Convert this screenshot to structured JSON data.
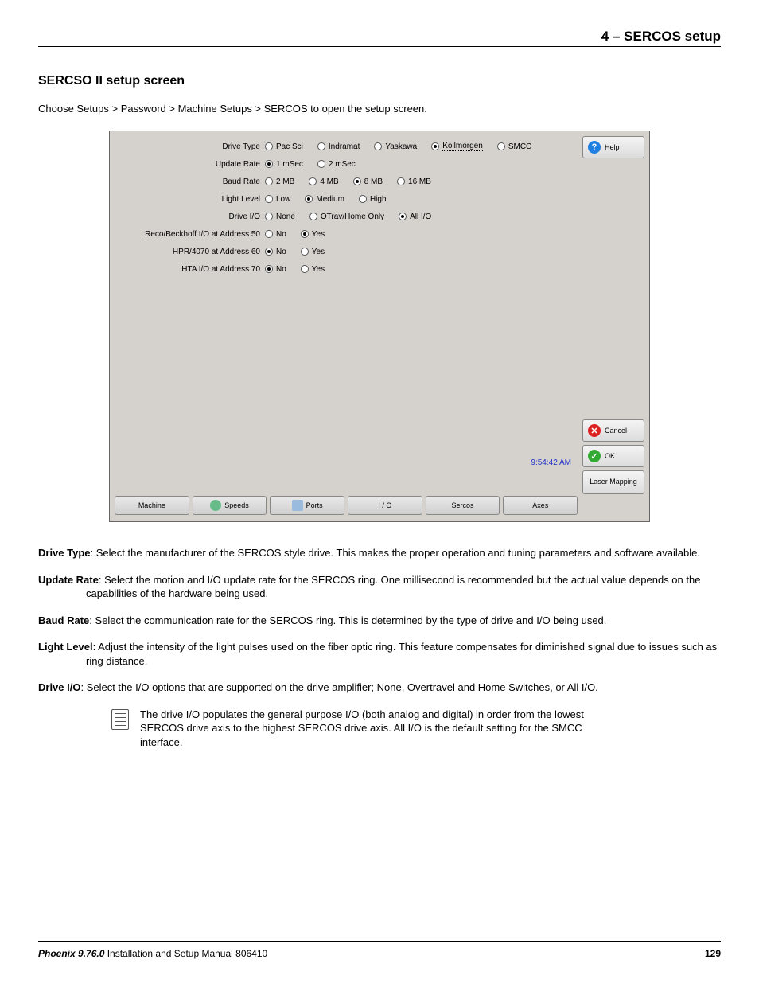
{
  "header": {
    "chapter": "4  –  SERCOS setup"
  },
  "section": {
    "title": "SERCSO II setup screen",
    "intro": "Choose Setups > Password > Machine Setups > SERCOS to open the setup screen."
  },
  "screenshot": {
    "rows": [
      {
        "label": "Drive Type",
        "options": [
          "Pac Sci",
          "Indramat",
          "Yaskawa",
          "Kollmorgen",
          "SMCC"
        ],
        "selected": 3,
        "dotted": 3
      },
      {
        "label": "Update Rate",
        "options": [
          "1 mSec",
          "2 mSec"
        ],
        "selected": 0
      },
      {
        "label": "Baud Rate",
        "options": [
          "2 MB",
          "4 MB",
          "8 MB",
          "16 MB"
        ],
        "selected": 2
      },
      {
        "label": "Light Level",
        "options": [
          "Low",
          "Medium",
          "High"
        ],
        "selected": 1
      },
      {
        "label": "Drive I/O",
        "options": [
          "None",
          "OTrav/Home Only",
          "All I/O"
        ],
        "selected": 2
      },
      {
        "label": "Reco/Beckhoff I/O at Address 50",
        "options": [
          "No",
          "Yes"
        ],
        "selected": 1
      },
      {
        "label": "HPR/4070 at Address 60",
        "options": [
          "No",
          "Yes"
        ],
        "selected": 0
      },
      {
        "label": "HTA I/O at Address 70",
        "options": [
          "No",
          "Yes"
        ],
        "selected": 0
      }
    ],
    "clock": "9:54:42 AM",
    "buttons": {
      "help": "Help",
      "cancel": "Cancel",
      "ok": "OK",
      "laser_mapping": "Laser Mapping"
    },
    "tabs": [
      "Machine",
      "Speeds",
      "Ports",
      "I / O",
      "Sercos",
      "Axes"
    ]
  },
  "definitions": [
    {
      "term": "Drive Type",
      "text": ": Select the manufacturer of the SERCOS style drive. This makes the proper operation and tuning parameters and software available."
    },
    {
      "term": "Update Rate",
      "text": ": Select the motion and I/O update rate for the SERCOS ring. One millisecond is recommended but the actual value depends on the capabilities of the hardware being used."
    },
    {
      "term": "Baud Rate",
      "text": ": Select the communication rate for the SERCOS ring. This is determined by the type of drive and I/O being used."
    },
    {
      "term": "Light Level",
      "text": ": Adjust the intensity of the light pulses used on the fiber optic ring. This feature compensates for diminished signal due to issues such as ring distance."
    },
    {
      "term": "Drive I/O",
      "text": ": Select the I/O options that are supported on the drive amplifier; None, Overtravel and Home Switches, or All I/O."
    }
  ],
  "note": "The drive I/O populates the general purpose I/O (both analog and digital) in order from the lowest SERCOS drive axis to the highest SERCOS drive axis. All I/O is the default setting for the SMCC interface.",
  "footer": {
    "product": "Phoenix 9.76.0",
    "manual": "  Installation and Setup Manual  806410",
    "page": "129"
  }
}
